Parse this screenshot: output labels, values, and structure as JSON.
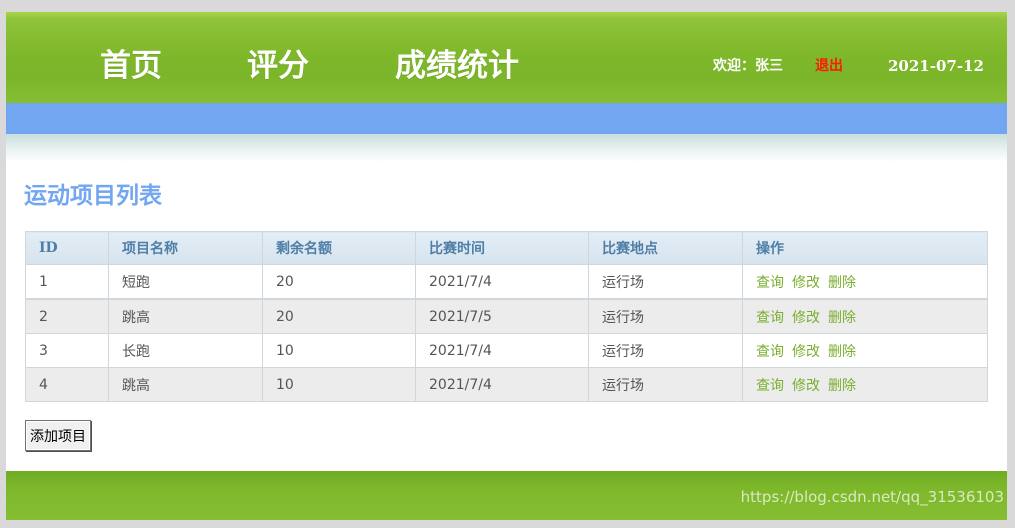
{
  "header": {
    "nav": [
      {
        "label": "首页"
      },
      {
        "label": "评分"
      },
      {
        "label": "成绩统计"
      }
    ],
    "welcome": "欢迎：张三",
    "logout": "退出",
    "date": "2021-07-12"
  },
  "main": {
    "title": "运动项目列表",
    "table": {
      "columns": [
        "ID",
        "项目名称",
        "剩余名额",
        "比赛时间",
        "比赛地点",
        "操作"
      ],
      "rows": [
        {
          "id": "1",
          "name": "短跑",
          "remaining": "20",
          "time": "2021/7/4",
          "place": "运行场"
        },
        {
          "id": "2",
          "name": "跳高",
          "remaining": "20",
          "time": "2021/7/5",
          "place": "运行场"
        },
        {
          "id": "3",
          "name": "长跑",
          "remaining": "10",
          "time": "2021/7/4",
          "place": "运行场"
        },
        {
          "id": "4",
          "name": "跳高",
          "remaining": "10",
          "time": "2021/7/4",
          "place": "运行场"
        }
      ],
      "actions": {
        "view": "查询",
        "edit": "修改",
        "delete": "删除"
      }
    },
    "add_button": "添加项目"
  },
  "watermark": "https://blog.csdn.net/qq_31536103",
  "colors": {
    "header_green": "#7fb82b",
    "blue_bar": "#73a6f1",
    "title_blue": "#73a6f1",
    "logout_red": "#ff1a00",
    "action_green": "#7aae2f"
  }
}
